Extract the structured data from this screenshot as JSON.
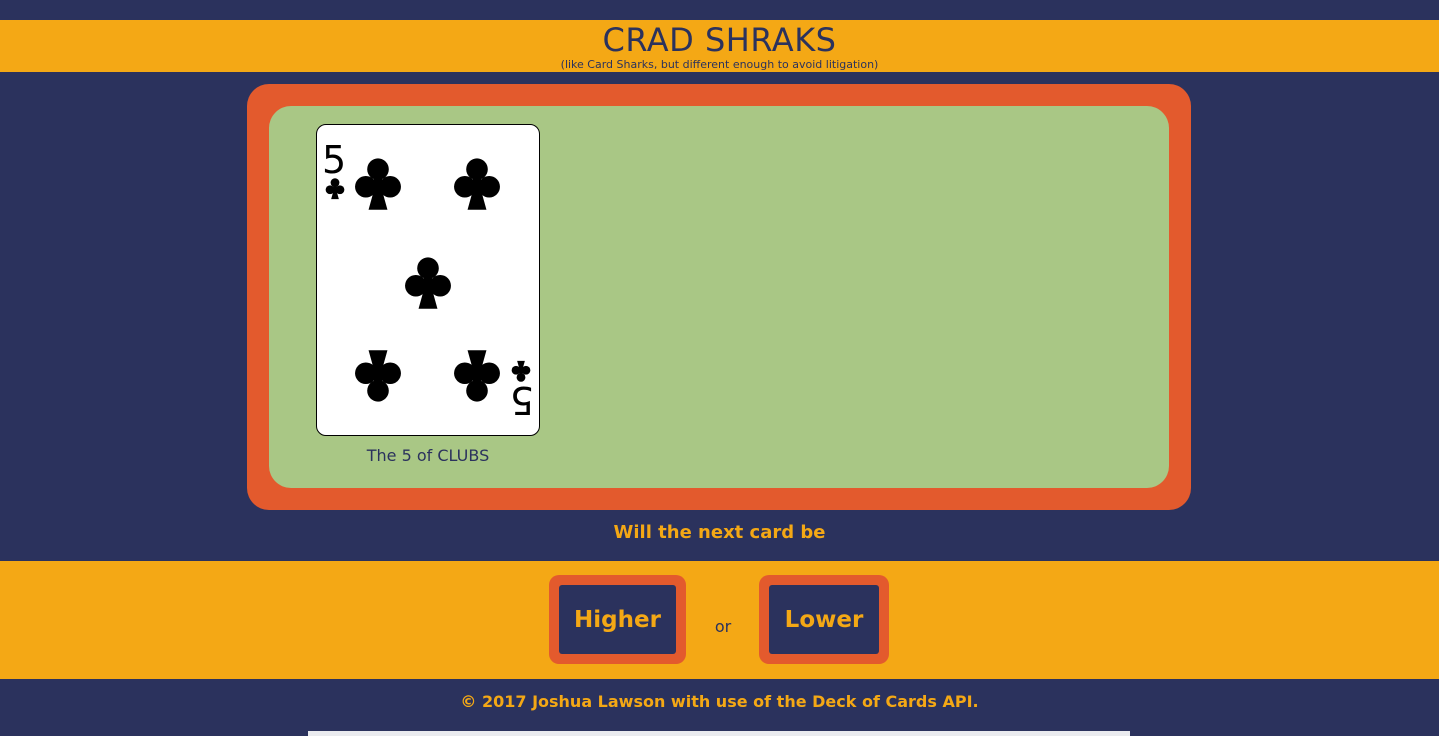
{
  "header": {
    "title": "CRAD SHRAKS",
    "subtitle": "(like Card Sharks, but different enough to avoid litigation)"
  },
  "card": {
    "rank": "5",
    "suit": "clubs",
    "caption": "The 5 of CLUBS"
  },
  "prompt": "Will the next card be",
  "controls": {
    "higher_label": "Higher",
    "or_label": "or",
    "lower_label": "Lower"
  },
  "footer": {
    "text": "© 2017 Joshua Lawson with use of the Deck of Cards API."
  },
  "colors": {
    "background": "#2b325d",
    "accent_yellow": "#f4a815",
    "accent_orange": "#e35a2d",
    "felt_green": "#a9c785"
  }
}
